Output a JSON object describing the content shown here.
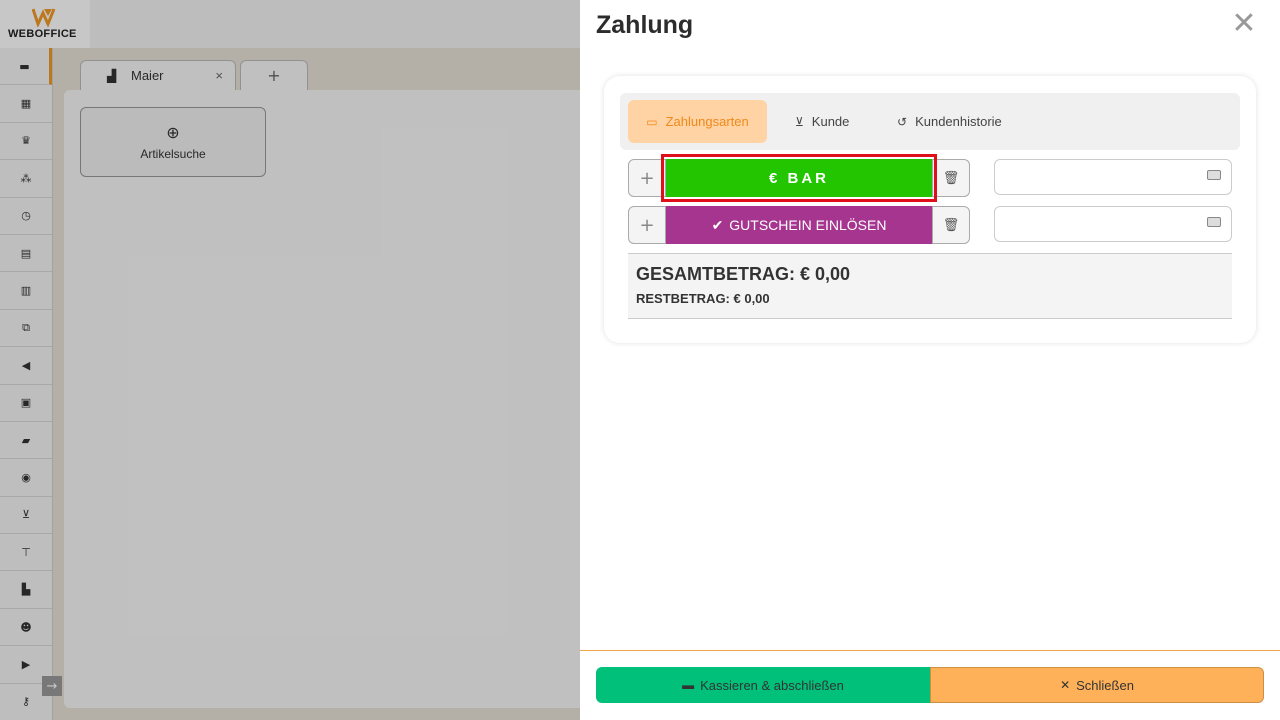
{
  "app": {
    "logo_text": "WEBOFFICE",
    "accent_color": "#f09a28"
  },
  "sidebar": {
    "items": [
      {
        "icon": "cash-register-icon"
      },
      {
        "icon": "calendar-icon"
      },
      {
        "icon": "crown-icon"
      },
      {
        "icon": "network-icon"
      },
      {
        "icon": "clock-icon"
      },
      {
        "icon": "document-icon"
      },
      {
        "icon": "list-document-icon"
      },
      {
        "icon": "boxes-icon"
      },
      {
        "icon": "megaphone-icon"
      },
      {
        "icon": "chart-icon"
      },
      {
        "icon": "folder-icon"
      },
      {
        "icon": "database-icon"
      },
      {
        "icon": "cart-icon"
      },
      {
        "icon": "hierarchy-icon"
      },
      {
        "icon": "industry-icon"
      },
      {
        "icon": "users-icon"
      },
      {
        "icon": "truck-icon"
      },
      {
        "icon": "key-icon"
      }
    ]
  },
  "doc_tabs": {
    "tab1_label": "Maier",
    "tab1_close": "×",
    "add_label": "+"
  },
  "workspace": {
    "tile_label": "Artikelsuche"
  },
  "modal": {
    "title": "Zahlung",
    "close_glyph": "✕",
    "tabs": {
      "zahlungsarten": "Zahlungsarten",
      "kunde": "Kunde",
      "kundenhistorie": "Kundenhistorie"
    },
    "payments": {
      "bar_label": "€ BAR",
      "bar_color": "#22c500",
      "gutschein_label": "GUTSCHEIN EINLÖSEN",
      "gutschein_color": "#a5358f",
      "plus_glyph": "+",
      "bar_amount": "",
      "gutschein_amount": ""
    },
    "totals": {
      "gesamt": "GESAMTBETRAG: € 0,00",
      "rest": "RESTBETRAG: € 0,00"
    },
    "footer": {
      "kassieren_label": "Kassieren & abschließen",
      "kassieren_color": "#00c07a",
      "schliessen_label": "Schließen",
      "schliessen_color": "#ffb15a"
    }
  }
}
